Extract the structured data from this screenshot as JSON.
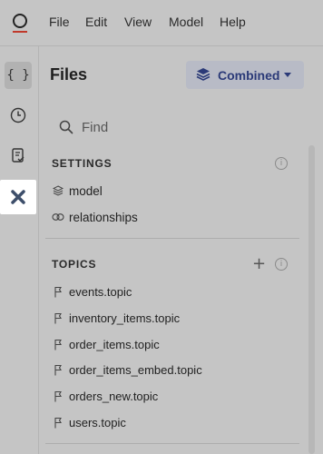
{
  "menubar": {
    "items": [
      {
        "label": "File"
      },
      {
        "label": "Edit"
      },
      {
        "label": "View"
      },
      {
        "label": "Model"
      },
      {
        "label": "Help"
      }
    ]
  },
  "rail": {
    "icons": [
      "braces-icon",
      "clock-icon",
      "clipboard-check-icon",
      "model-x-icon"
    ]
  },
  "files": {
    "title": "Files",
    "view_selector": "Combined"
  },
  "search": {
    "placeholder": "Find"
  },
  "settings": {
    "title": "SETTINGS",
    "items": [
      {
        "label": "model",
        "icon": "layers-icon"
      },
      {
        "label": "relationships",
        "icon": "link-icon"
      }
    ]
  },
  "topics": {
    "title": "TOPICS",
    "items": [
      {
        "label": "events.topic"
      },
      {
        "label": "inventory_items.topic"
      },
      {
        "label": "order_items.topic"
      },
      {
        "label": "order_items_embed.topic"
      },
      {
        "label": "orders_new.topic"
      },
      {
        "label": "users.topic"
      }
    ]
  },
  "colors": {
    "background": "#c5c5c5",
    "accent": "#2b3a78",
    "logo_underline": "#c0392b"
  }
}
